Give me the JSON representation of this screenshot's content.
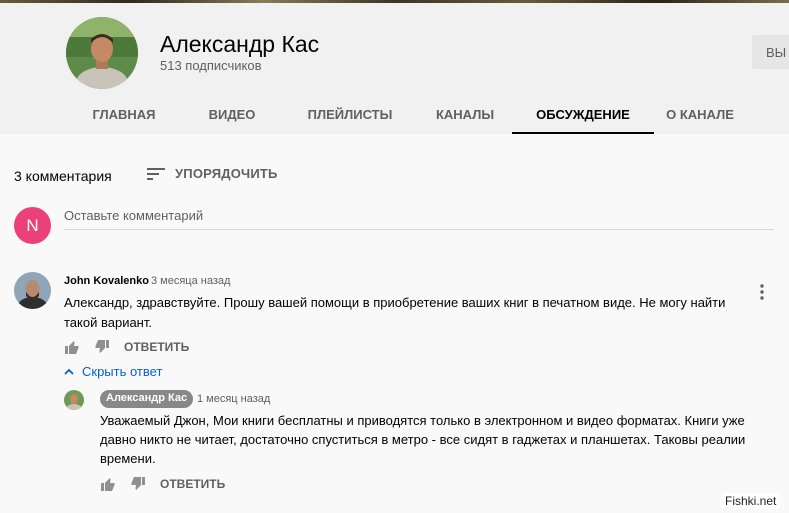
{
  "channel": {
    "name": "Александр Кас",
    "subscribers": "513 подписчиков",
    "subscribe_label": "ВЫ"
  },
  "tabs": [
    {
      "label": "ГЛАВНАЯ"
    },
    {
      "label": "ВИДЕО"
    },
    {
      "label": "ПЛЕЙЛИСТЫ"
    },
    {
      "label": "КАНАЛЫ"
    },
    {
      "label": "ОБСУЖДЕНИЕ",
      "active": true
    },
    {
      "label": "О КАНАЛЕ"
    }
  ],
  "comments_header": {
    "count": "3 комментария",
    "sort_label": "УПОРЯДОЧИТЬ"
  },
  "add_comment": {
    "avatar_letter": "N",
    "avatar_color": "#ec407a",
    "placeholder": "Оставьте комментарий"
  },
  "comment": {
    "author": "John Kovalenko",
    "time": "3 месяца назад",
    "text": "Александр, здравствуйте. Прошу вашей помощи в приобретение ваших книг в печатном виде. Не могу найти такой вариант.",
    "reply_label": "ОТВЕТИТЬ",
    "hide_replies_label": "Скрыть ответ"
  },
  "reply": {
    "author": "Александр Кас",
    "time": "1 месяц назад",
    "text": "Уважаемый Джон, Мои книги бесплатны и приводятся только в электронном и видео форматах. Книги уже давно никто не читает, достаточно спуститься в метро - все сидят в гаджетах и планшетах. Таковы реалии времени.",
    "reply_label": "ОТВЕТИТЬ"
  },
  "watermark": "Fishki.net",
  "colors": {
    "link": "#065fd4",
    "owner_badge": "#888888",
    "text_secondary": "#606060"
  }
}
